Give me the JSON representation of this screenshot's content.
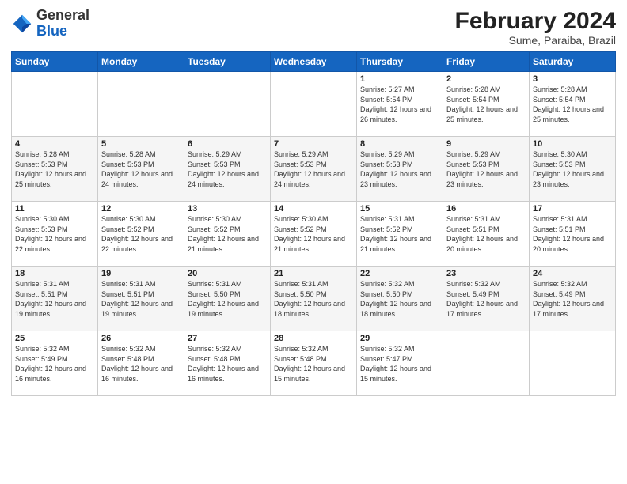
{
  "header": {
    "logo_general": "General",
    "logo_blue": "Blue",
    "title": "February 2024",
    "subtitle": "Sume, Paraiba, Brazil"
  },
  "columns": [
    "Sunday",
    "Monday",
    "Tuesday",
    "Wednesday",
    "Thursday",
    "Friday",
    "Saturday"
  ],
  "weeks": [
    [
      {
        "day": "",
        "sunrise": "",
        "sunset": "",
        "daylight": ""
      },
      {
        "day": "",
        "sunrise": "",
        "sunset": "",
        "daylight": ""
      },
      {
        "day": "",
        "sunrise": "",
        "sunset": "",
        "daylight": ""
      },
      {
        "day": "",
        "sunrise": "",
        "sunset": "",
        "daylight": ""
      },
      {
        "day": "1",
        "sunrise": "Sunrise: 5:27 AM",
        "sunset": "Sunset: 5:54 PM",
        "daylight": "Daylight: 12 hours and 26 minutes."
      },
      {
        "day": "2",
        "sunrise": "Sunrise: 5:28 AM",
        "sunset": "Sunset: 5:54 PM",
        "daylight": "Daylight: 12 hours and 25 minutes."
      },
      {
        "day": "3",
        "sunrise": "Sunrise: 5:28 AM",
        "sunset": "Sunset: 5:54 PM",
        "daylight": "Daylight: 12 hours and 25 minutes."
      }
    ],
    [
      {
        "day": "4",
        "sunrise": "Sunrise: 5:28 AM",
        "sunset": "Sunset: 5:53 PM",
        "daylight": "Daylight: 12 hours and 25 minutes."
      },
      {
        "day": "5",
        "sunrise": "Sunrise: 5:28 AM",
        "sunset": "Sunset: 5:53 PM",
        "daylight": "Daylight: 12 hours and 24 minutes."
      },
      {
        "day": "6",
        "sunrise": "Sunrise: 5:29 AM",
        "sunset": "Sunset: 5:53 PM",
        "daylight": "Daylight: 12 hours and 24 minutes."
      },
      {
        "day": "7",
        "sunrise": "Sunrise: 5:29 AM",
        "sunset": "Sunset: 5:53 PM",
        "daylight": "Daylight: 12 hours and 24 minutes."
      },
      {
        "day": "8",
        "sunrise": "Sunrise: 5:29 AM",
        "sunset": "Sunset: 5:53 PM",
        "daylight": "Daylight: 12 hours and 23 minutes."
      },
      {
        "day": "9",
        "sunrise": "Sunrise: 5:29 AM",
        "sunset": "Sunset: 5:53 PM",
        "daylight": "Daylight: 12 hours and 23 minutes."
      },
      {
        "day": "10",
        "sunrise": "Sunrise: 5:30 AM",
        "sunset": "Sunset: 5:53 PM",
        "daylight": "Daylight: 12 hours and 23 minutes."
      }
    ],
    [
      {
        "day": "11",
        "sunrise": "Sunrise: 5:30 AM",
        "sunset": "Sunset: 5:53 PM",
        "daylight": "Daylight: 12 hours and 22 minutes."
      },
      {
        "day": "12",
        "sunrise": "Sunrise: 5:30 AM",
        "sunset": "Sunset: 5:52 PM",
        "daylight": "Daylight: 12 hours and 22 minutes."
      },
      {
        "day": "13",
        "sunrise": "Sunrise: 5:30 AM",
        "sunset": "Sunset: 5:52 PM",
        "daylight": "Daylight: 12 hours and 21 minutes."
      },
      {
        "day": "14",
        "sunrise": "Sunrise: 5:30 AM",
        "sunset": "Sunset: 5:52 PM",
        "daylight": "Daylight: 12 hours and 21 minutes."
      },
      {
        "day": "15",
        "sunrise": "Sunrise: 5:31 AM",
        "sunset": "Sunset: 5:52 PM",
        "daylight": "Daylight: 12 hours and 21 minutes."
      },
      {
        "day": "16",
        "sunrise": "Sunrise: 5:31 AM",
        "sunset": "Sunset: 5:51 PM",
        "daylight": "Daylight: 12 hours and 20 minutes."
      },
      {
        "day": "17",
        "sunrise": "Sunrise: 5:31 AM",
        "sunset": "Sunset: 5:51 PM",
        "daylight": "Daylight: 12 hours and 20 minutes."
      }
    ],
    [
      {
        "day": "18",
        "sunrise": "Sunrise: 5:31 AM",
        "sunset": "Sunset: 5:51 PM",
        "daylight": "Daylight: 12 hours and 19 minutes."
      },
      {
        "day": "19",
        "sunrise": "Sunrise: 5:31 AM",
        "sunset": "Sunset: 5:51 PM",
        "daylight": "Daylight: 12 hours and 19 minutes."
      },
      {
        "day": "20",
        "sunrise": "Sunrise: 5:31 AM",
        "sunset": "Sunset: 5:50 PM",
        "daylight": "Daylight: 12 hours and 19 minutes."
      },
      {
        "day": "21",
        "sunrise": "Sunrise: 5:31 AM",
        "sunset": "Sunset: 5:50 PM",
        "daylight": "Daylight: 12 hours and 18 minutes."
      },
      {
        "day": "22",
        "sunrise": "Sunrise: 5:32 AM",
        "sunset": "Sunset: 5:50 PM",
        "daylight": "Daylight: 12 hours and 18 minutes."
      },
      {
        "day": "23",
        "sunrise": "Sunrise: 5:32 AM",
        "sunset": "Sunset: 5:49 PM",
        "daylight": "Daylight: 12 hours and 17 minutes."
      },
      {
        "day": "24",
        "sunrise": "Sunrise: 5:32 AM",
        "sunset": "Sunset: 5:49 PM",
        "daylight": "Daylight: 12 hours and 17 minutes."
      }
    ],
    [
      {
        "day": "25",
        "sunrise": "Sunrise: 5:32 AM",
        "sunset": "Sunset: 5:49 PM",
        "daylight": "Daylight: 12 hours and 16 minutes."
      },
      {
        "day": "26",
        "sunrise": "Sunrise: 5:32 AM",
        "sunset": "Sunset: 5:48 PM",
        "daylight": "Daylight: 12 hours and 16 minutes."
      },
      {
        "day": "27",
        "sunrise": "Sunrise: 5:32 AM",
        "sunset": "Sunset: 5:48 PM",
        "daylight": "Daylight: 12 hours and 16 minutes."
      },
      {
        "day": "28",
        "sunrise": "Sunrise: 5:32 AM",
        "sunset": "Sunset: 5:48 PM",
        "daylight": "Daylight: 12 hours and 15 minutes."
      },
      {
        "day": "29",
        "sunrise": "Sunrise: 5:32 AM",
        "sunset": "Sunset: 5:47 PM",
        "daylight": "Daylight: 12 hours and 15 minutes."
      },
      {
        "day": "",
        "sunrise": "",
        "sunset": "",
        "daylight": ""
      },
      {
        "day": "",
        "sunrise": "",
        "sunset": "",
        "daylight": ""
      }
    ]
  ]
}
